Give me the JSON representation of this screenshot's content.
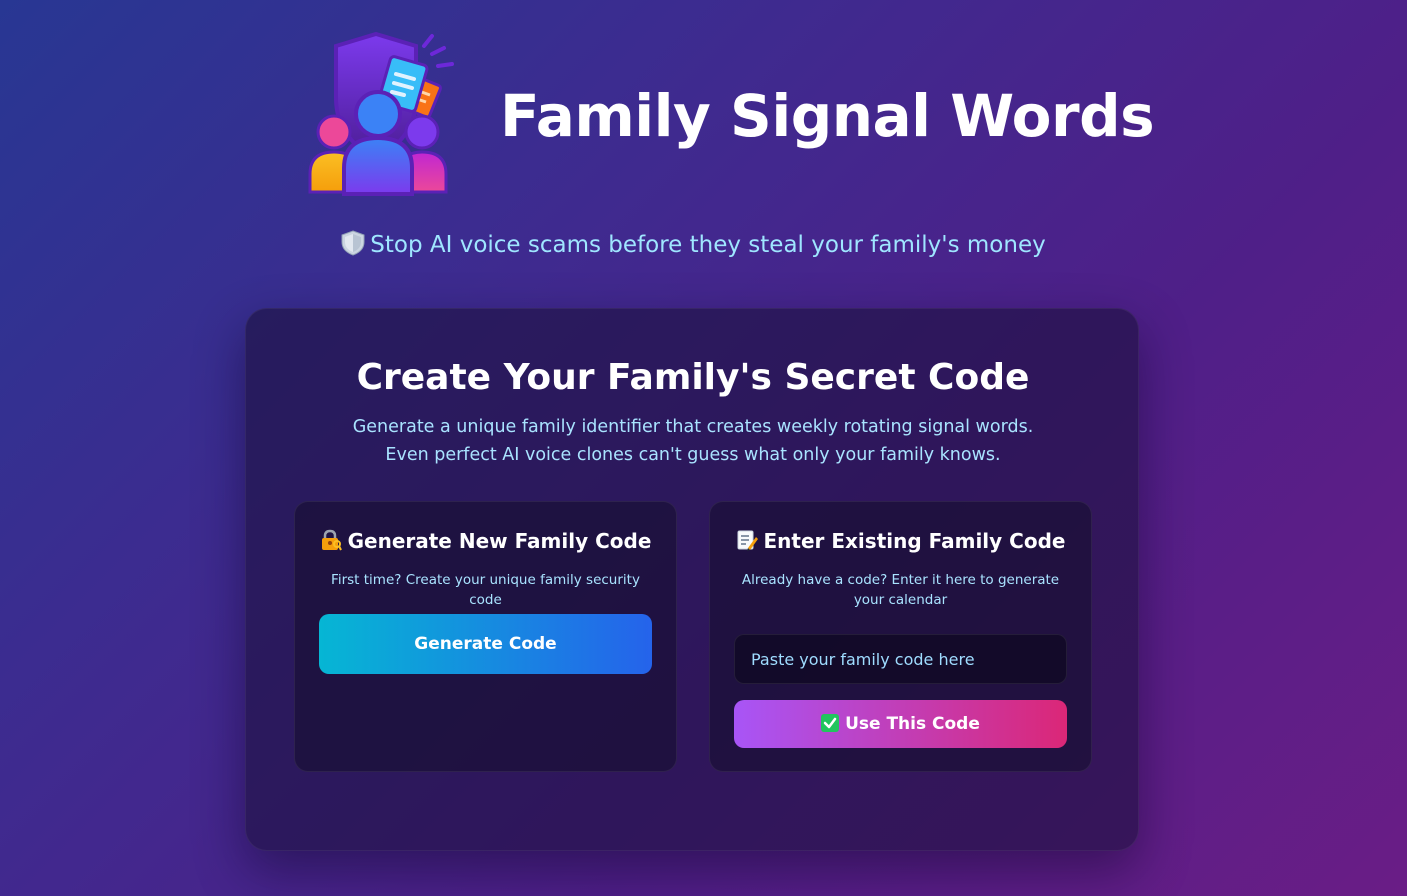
{
  "header": {
    "logo_icon": "family-shield-logo-icon",
    "title": "Family Signal Words",
    "tagline_icon": "shield-icon",
    "tagline": "Stop AI voice scams before they steal your family's money"
  },
  "main": {
    "title": "Create Your Family's Secret Code",
    "description_line1": "Generate a unique family identifier that creates weekly rotating signal words.",
    "description_line2": "Even perfect AI voice clones can't guess what only your family knows."
  },
  "generate_card": {
    "icon": "lock-with-key-icon",
    "title": "Generate New Family Code",
    "description": "First time? Create your unique family security code",
    "button_label": "Generate Code"
  },
  "existing_card": {
    "icon": "memo-icon",
    "title": "Enter Existing Family Code",
    "description": "Already have a code? Enter it here to generate your calendar",
    "input_placeholder": "Paste your family code here",
    "input_value": "",
    "button_icon": "check-mark-icon",
    "button_label": "Use This Code"
  },
  "colors": {
    "background_start": "#283793",
    "background_end": "#6a1d86",
    "accent_text": "#9fe6ff",
    "generate_button_start": "#06b6d4",
    "generate_button_end": "#2563eb",
    "use_button_start": "#a855f7",
    "use_button_end": "#db2777"
  }
}
